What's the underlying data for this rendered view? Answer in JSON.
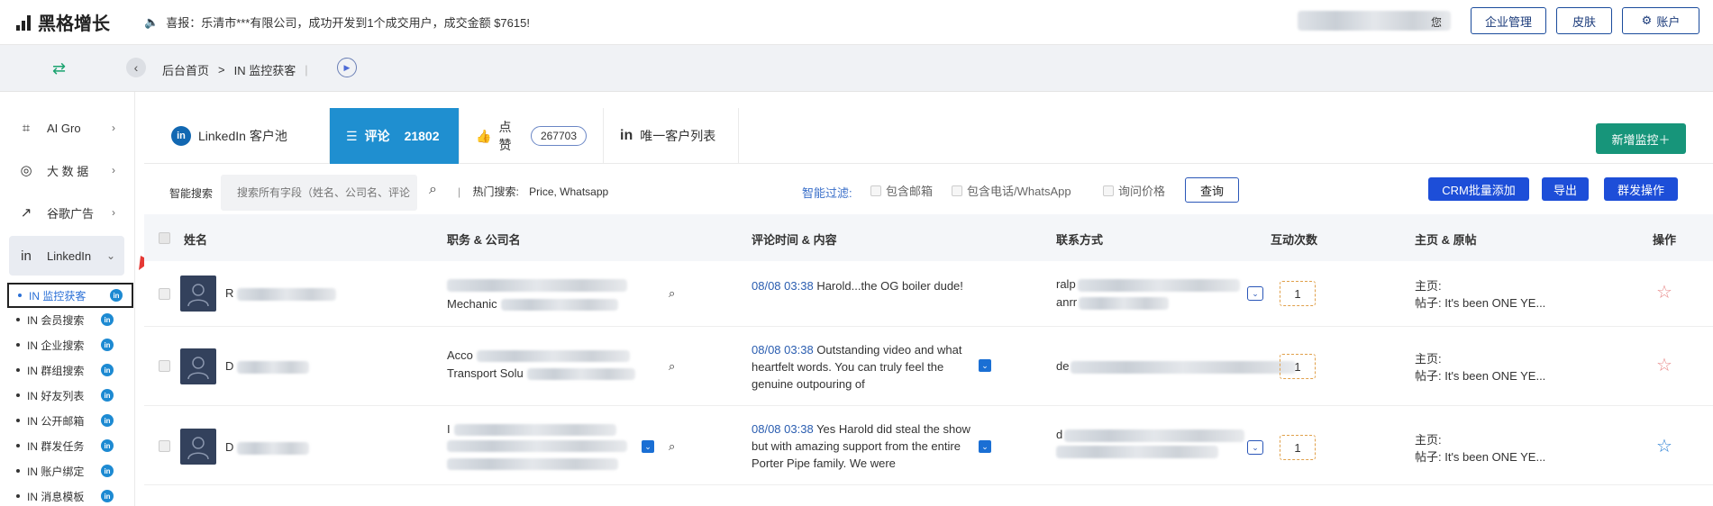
{
  "brand": {
    "name": "黑格增长"
  },
  "notice": {
    "text": "喜报：乐清市***有限公司，成功开发到1个成交用户，成交金额 $7615!"
  },
  "header": {
    "greeting": "您",
    "buttons": [
      "企业管理",
      "皮肤",
      "账户"
    ]
  },
  "breadcrumb": {
    "home": "后台首页",
    "separator": ">",
    "current": "IN 监控获客"
  },
  "sidebar": {
    "items": [
      {
        "label": "AI Gro",
        "icon": "chip-icon"
      },
      {
        "label": "大 数 据",
        "icon": "compass-icon"
      },
      {
        "label": "谷歌广告",
        "icon": "trend-icon"
      },
      {
        "label": "LinkedIn",
        "icon": "linkedin-icon"
      }
    ],
    "sub_items": [
      "IN 监控获客",
      "IN 会员搜索",
      "IN 企业搜索",
      "IN 群组搜索",
      "IN 好友列表",
      "IN 公开邮箱",
      "IN 群发任务",
      "IN 账户绑定",
      "IN 消息模板"
    ],
    "selected_sub": "IN 监控获客"
  },
  "tabs": [
    {
      "label": "LinkedIn 客户池"
    },
    {
      "label": "评论",
      "count": "21802"
    },
    {
      "label": "点赞",
      "count": "267703"
    },
    {
      "label": "唯一客户列表"
    }
  ],
  "new_monitor_label": "新增监控＋",
  "filter": {
    "search_label": "智能搜索",
    "search_placeholder": "搜索所有字段（姓名、公司名、评论",
    "hot_label": "热门搜索:",
    "hot_terms": "Price, Whatsapp",
    "smart_label": "智能过滤:",
    "options": [
      "包含邮箱",
      "包含电话/WhatsApp",
      "询问价格"
    ],
    "query_label": "查询",
    "crm_label": "CRM批量添加",
    "export_label": "导出",
    "mass_label": "群发操作"
  },
  "columns": [
    "姓名",
    "职务 & 公司名",
    "评论时间 & 内容",
    "联系方式",
    "互动次数",
    "主页 & 原帖",
    "操作"
  ],
  "rows": [
    {
      "name": "R",
      "job": "Mechanic",
      "time": "08/08 03:38",
      "comment": "Harold...the OG boiler dude!",
      "contact": "ralp",
      "contact2": "anrr",
      "count": "1",
      "home": "主页:",
      "post": "帖子: It's been ONE YE...",
      "starred": false
    },
    {
      "name": "D",
      "job": "Transport Solu",
      "job_pre": "Acco",
      "time": "08/08 03:38",
      "comment": "Outstanding video and what heartfelt words. You can truly feel the genuine outpouring of",
      "contact": "de",
      "count": "1",
      "home": "主页:",
      "post": "帖子: It's been ONE YE...",
      "starred": false
    },
    {
      "name": "D",
      "job": "I",
      "time": "08/08 03:38",
      "comment": "Yes Harold did steal the show but with amazing support from the entire Porter Pipe family. We were",
      "contact": "d",
      "count": "1",
      "home": "主页:",
      "post": "帖子: It's been ONE YE...",
      "starred": true
    }
  ],
  "colors": {
    "accent": "#1f8fd0",
    "green": "#17957a",
    "blue_btn": "#1d4ed8"
  }
}
